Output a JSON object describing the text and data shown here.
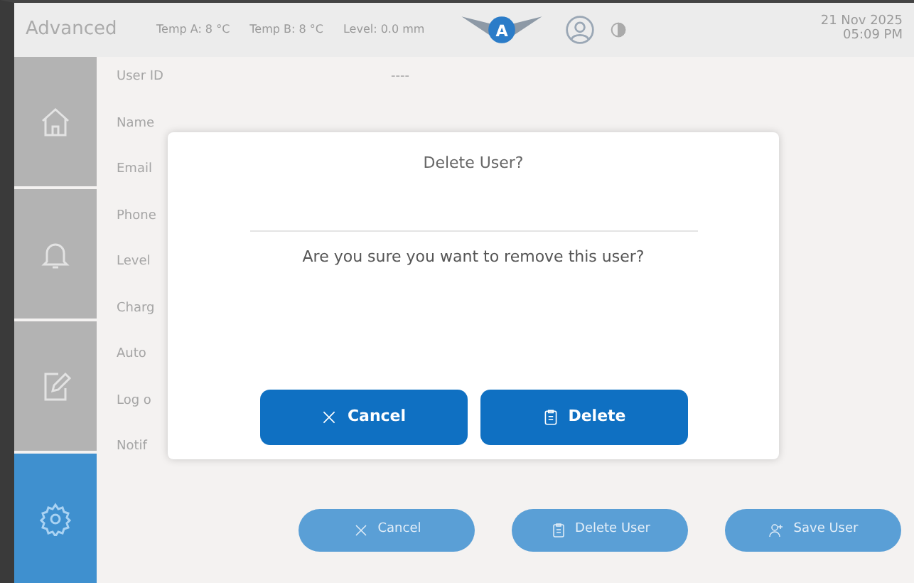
{
  "header": {
    "title": "Advanced",
    "readings": [
      "Temp A: 8 °C",
      "Temp B: 8 °C",
      "Level: 0.0 mm"
    ],
    "logo_letter": "A",
    "date": "21 Nov 2025",
    "time": "05:09 PM"
  },
  "sidebar": {
    "items": [
      {
        "kind": "home",
        "selected": false
      },
      {
        "kind": "bell",
        "selected": false
      },
      {
        "kind": "edit",
        "selected": false
      },
      {
        "kind": "gear",
        "selected": true
      }
    ]
  },
  "form": {
    "fields": [
      {
        "label": "User ID",
        "value": "----"
      },
      {
        "label": "Name"
      },
      {
        "label": "Email"
      },
      {
        "label": "Phone"
      },
      {
        "label": "Level"
      },
      {
        "label": "Charg"
      },
      {
        "label": "Auto"
      },
      {
        "label": "Log o"
      },
      {
        "label": "Notif"
      }
    ]
  },
  "actions": [
    {
      "kind": "cancel",
      "label": "Cancel"
    },
    {
      "kind": "delete",
      "label": "Delete User"
    },
    {
      "kind": "save",
      "label": "Save User"
    }
  ],
  "dialog": {
    "title": "Delete User?",
    "message": "Are you sure you want to remove this user?",
    "buttons": [
      {
        "kind": "cancel",
        "label": "Cancel"
      },
      {
        "kind": "delete",
        "label": "Delete"
      }
    ]
  }
}
